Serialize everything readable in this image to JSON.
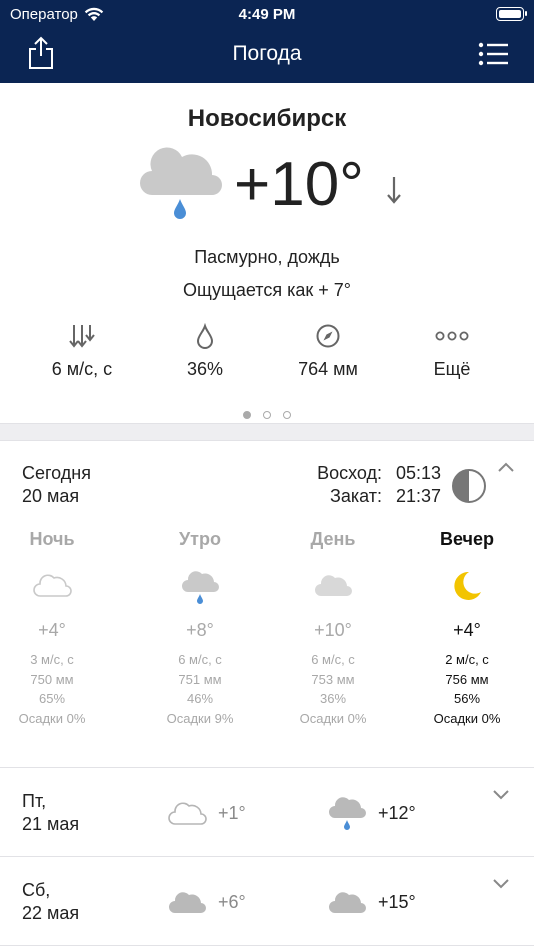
{
  "status_bar": {
    "carrier": "Оператор",
    "time": "4:49 PM"
  },
  "nav": {
    "title": "Погода"
  },
  "current": {
    "city": "Новосибирск",
    "temperature": "+10°",
    "condition": "Пасмурно, дождь",
    "feels_like": "Ощущается как + 7°",
    "metrics": [
      {
        "icon": "wind-icon",
        "value": "6 м/с, с"
      },
      {
        "icon": "humidity-icon",
        "value": "36%"
      },
      {
        "icon": "pressure-icon",
        "value": "764 мм"
      },
      {
        "icon": "more-icon",
        "value": "Ещё"
      }
    ]
  },
  "today": {
    "day": "Сегодня",
    "date": "20 мая",
    "sunrise_label": "Восход:",
    "sunrise": "05:13",
    "sunset_label": "Закат:",
    "sunset": "21:37",
    "periods": [
      {
        "name": "Ночь",
        "icon": "cloud-outline-icon",
        "temp": "+4°",
        "wind": "3 м/с, с",
        "pressure": "750 мм",
        "humidity": "65%",
        "precip": "Осадки 0%"
      },
      {
        "name": "Утро",
        "icon": "rain-cloud-icon",
        "temp": "+8°",
        "wind": "6 м/с, с",
        "pressure": "751 мм",
        "humidity": "46%",
        "precip": "Осадки 9%"
      },
      {
        "name": "День",
        "icon": "cloud-icon",
        "temp": "+10°",
        "wind": "6 м/с, с",
        "pressure": "753 мм",
        "humidity": "36%",
        "precip": "Осадки 0%"
      },
      {
        "name": "Вечер",
        "icon": "moon-icon",
        "temp": "+4°",
        "wind": "2 м/с, с",
        "pressure": "756 мм",
        "humidity": "56%",
        "precip": "Осадки 0%"
      }
    ]
  },
  "forecast": [
    {
      "day": "Пт,",
      "date": "21 мая",
      "night_icon": "cloud-outline-icon",
      "night_temp": "+1°",
      "day_icon": "rain-cloud-icon",
      "day_temp": "+12°"
    },
    {
      "day": "Сб,",
      "date": "22 мая",
      "night_icon": "cloud-icon",
      "night_temp": "+6°",
      "day_icon": "cloud-icon",
      "day_temp": "+15°"
    }
  ],
  "colors": {
    "header": "#0b2553",
    "rain": "#4a8ed6",
    "moon": "#f2c400",
    "cloud": "#c9c9c9"
  }
}
